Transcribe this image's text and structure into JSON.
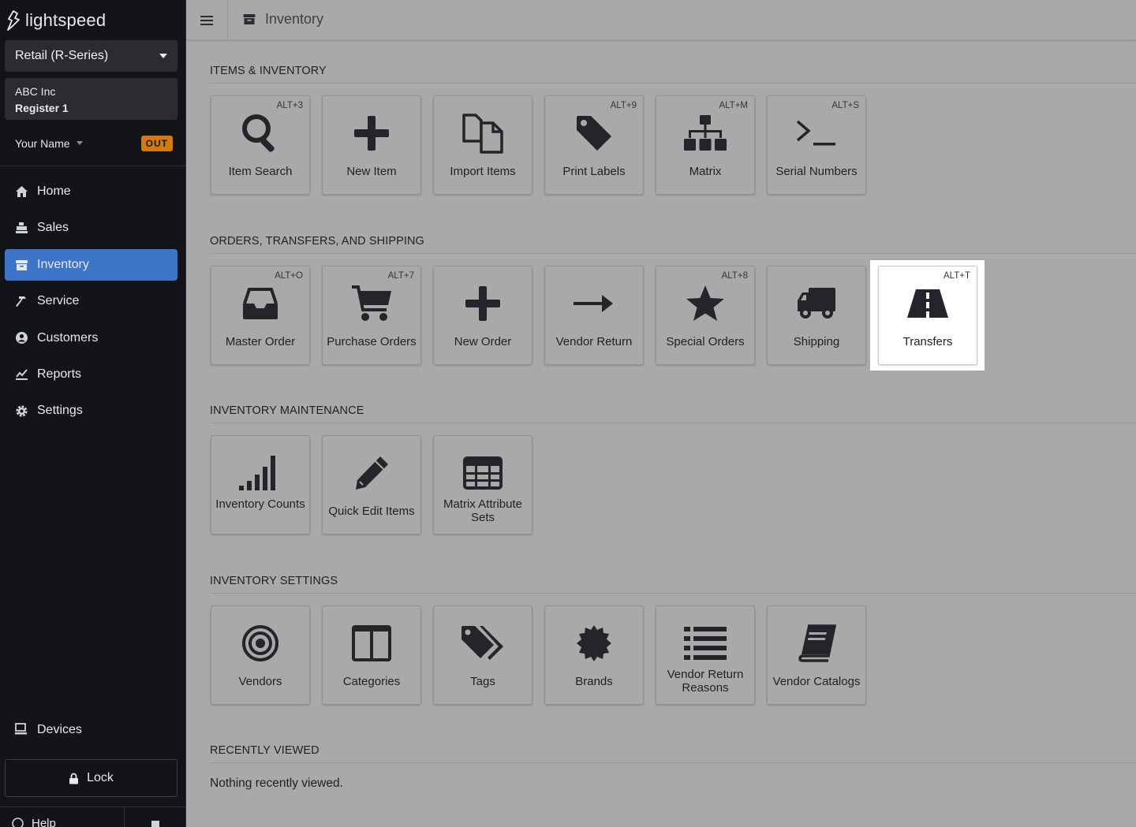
{
  "app": {
    "brand": "lightspeed"
  },
  "sidebar": {
    "store_selector": "Retail (R-Series)",
    "company": "ABC Inc",
    "register": "Register 1",
    "user_name": "Your Name",
    "clock_badge": "OUT",
    "nav": [
      {
        "label": "Home",
        "icon": "home-icon"
      },
      {
        "label": "Sales",
        "icon": "register-icon"
      },
      {
        "label": "Inventory",
        "icon": "archive-icon",
        "active": true
      },
      {
        "label": "Service",
        "icon": "hammer-icon"
      },
      {
        "label": "Customers",
        "icon": "user-circle-icon"
      },
      {
        "label": "Reports",
        "icon": "chart-icon"
      },
      {
        "label": "Settings",
        "icon": "gear-icon"
      }
    ],
    "devices": "Devices",
    "lock": "Lock",
    "help": "Help"
  },
  "topbar": {
    "title": "Inventory"
  },
  "sections": [
    {
      "title": "ITEMS & INVENTORY",
      "tiles": [
        {
          "label": "Item Search",
          "shortcut": "ALT+3",
          "icon": "search-icon"
        },
        {
          "label": "New Item",
          "shortcut": "",
          "icon": "plus-icon"
        },
        {
          "label": "Import Items",
          "shortcut": "",
          "icon": "copy-icon"
        },
        {
          "label": "Print Labels",
          "shortcut": "ALT+9",
          "icon": "tag-icon"
        },
        {
          "label": "Matrix",
          "shortcut": "ALT+M",
          "icon": "sitemap-icon"
        },
        {
          "label": "Serial Numbers",
          "shortcut": "ALT+S",
          "icon": "terminal-icon"
        }
      ]
    },
    {
      "title": "ORDERS, TRANSFERS, AND SHIPPING",
      "tiles": [
        {
          "label": "Master Order",
          "shortcut": "ALT+O",
          "icon": "inbox-icon"
        },
        {
          "label": "Purchase Orders",
          "shortcut": "ALT+7",
          "icon": "cart-icon"
        },
        {
          "label": "New Order",
          "shortcut": "",
          "icon": "plus-icon"
        },
        {
          "label": "Vendor Return",
          "shortcut": "",
          "icon": "arrow-right-icon"
        },
        {
          "label": "Special Orders",
          "shortcut": "ALT+8",
          "icon": "star-icon"
        },
        {
          "label": "Shipping",
          "shortcut": "",
          "icon": "truck-icon"
        },
        {
          "label": "Transfers",
          "shortcut": "ALT+T",
          "icon": "road-icon",
          "highlighted": true
        }
      ]
    },
    {
      "title": "INVENTORY MAINTENANCE",
      "tiles": [
        {
          "label": "Inventory Counts",
          "shortcut": "",
          "icon": "signal-icon"
        },
        {
          "label": "Quick Edit Items",
          "shortcut": "",
          "icon": "pencil-icon"
        },
        {
          "label": "Matrix Attribute Sets",
          "shortcut": "",
          "icon": "table-icon"
        }
      ]
    },
    {
      "title": "INVENTORY SETTINGS",
      "tiles": [
        {
          "label": "Vendors",
          "shortcut": "",
          "icon": "bullseye-icon"
        },
        {
          "label": "Categories",
          "shortcut": "",
          "icon": "columns-icon"
        },
        {
          "label": "Tags",
          "shortcut": "",
          "icon": "tags-icon"
        },
        {
          "label": "Brands",
          "shortcut": "",
          "icon": "certificate-icon"
        },
        {
          "label": "Vendor Return Reasons",
          "shortcut": "",
          "icon": "list-icon"
        },
        {
          "label": "Vendor Catalogs",
          "shortcut": "",
          "icon": "book-icon"
        }
      ]
    },
    {
      "title": "RECENTLY VIEWED",
      "empty_text": "Nothing recently viewed."
    }
  ],
  "colors": {
    "sidebar_bg": "#121418",
    "active_nav": "#3f75c9",
    "badge": "#d27a0e",
    "icon": "#23252b"
  }
}
